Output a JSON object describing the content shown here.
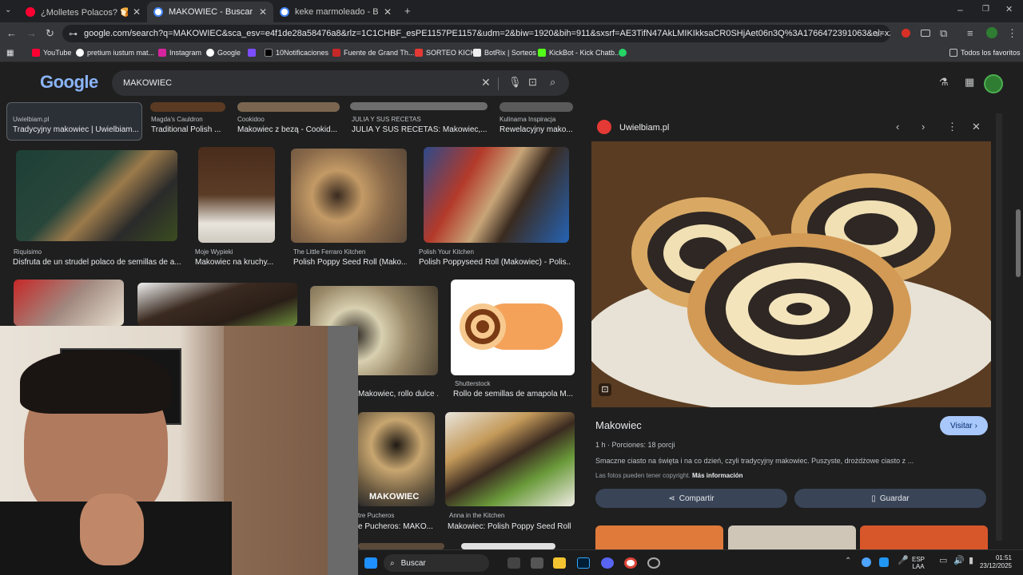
{
  "browser": {
    "tabs": [
      {
        "title": "¿Molletes Polacos? 🍞🇵🇱 #craco",
        "active": false
      },
      {
        "title": "MAKOWIEC - Buscar con Googl",
        "active": true
      },
      {
        "title": "keke marmoleado - Buscar con",
        "active": false
      }
    ],
    "url": "google.com/search?q=MAKOWIEC&sca_esv=e4f1de28a58476a8&rlz=1C1CHBF_esPE1157PE1157&udm=2&biw=1920&bih=911&sxsrf=AE3TifN47AkLMIKIkksaCR0SHjAet06n3Q%3A1766472391063&ei=xzpKabrPA6bU1sQP5qCz-Qc&ved...",
    "bookmarks": [
      "YouTube",
      "pretium iustum mat...",
      "Instagram",
      "Google",
      "",
      "10Notificaciones",
      "Fuente de Grand Th...",
      "SORTEO KICK",
      "BotRix | Sorteos",
      "KickBot - Kick Chatb...",
      "",
      "Todos los favoritos"
    ]
  },
  "google": {
    "logo": "Google",
    "query": "MAKOWIEC"
  },
  "results": {
    "row0": [
      {
        "source": "Uwielbiam.pl",
        "title": "Tradycyjny makowiec | Uwielbiam..."
      },
      {
        "source": "Magda's Cauldron",
        "title": "Traditional Polish ..."
      },
      {
        "source": "Cookidoo",
        "title": "Makowiec z bezą - Cookid..."
      },
      {
        "source": "JULIA Y SUS RECETAS",
        "title": "JULIA Y SUS RECETAS: Makowiec,..."
      },
      {
        "source": "Kulinarna Inspiracja",
        "title": "Rewelacyjny mako..."
      }
    ],
    "row1": [
      {
        "source": "Riquisimo",
        "title": "Disfruta de un strudel polaco de semillas de a..."
      },
      {
        "source": "Moje Wypieki",
        "title": "Makowiec na kruchy..."
      },
      {
        "source": "The Little Ferraro Kitchen",
        "title": "Polish Poppy Seed Roll (Mako..."
      },
      {
        "source": "Polish Your Kitchen",
        "title": "Polish Poppyseed Roll (Makowiec) - Polis..."
      }
    ],
    "row2": [
      {
        "source": "",
        "title": "Makowiec, rollo dulce ..."
      },
      {
        "source": "Shutterstock",
        "title": "Rollo de semillas de amapola M..."
      }
    ],
    "row3": [
      {
        "source": "tre Pucheros",
        "title": "e Pucheros: MAKO..."
      },
      {
        "source": "Anna in the Kitchen",
        "title": "Makowiec: Polish Poppy Seed Roll"
      }
    ],
    "image_text": "MAKOWIEC"
  },
  "panel": {
    "source": "Uwielbiam.pl",
    "title": "Makowiec",
    "visit_label": "Visitar",
    "meta": "1 h · Porciones: 18 porcji",
    "description": "Smaczne ciasto na święta i na co dzień, czyli tradycyjny makowiec. Puszyste, drożdżowe ciasto z ...",
    "copyright": "Las fotos pueden tener copyright.",
    "more_info": "Más información",
    "share_label": "Compartir",
    "save_label": "Guardar"
  },
  "taskbar": {
    "search_label": "Buscar",
    "lang": "ESP",
    "lang2": "LAA",
    "time": "01:51",
    "date": "23/12/2025"
  },
  "colors": {
    "accent": "#8ab4f8",
    "visit_bg": "#a8c7fa",
    "button_bg": "#394457"
  }
}
